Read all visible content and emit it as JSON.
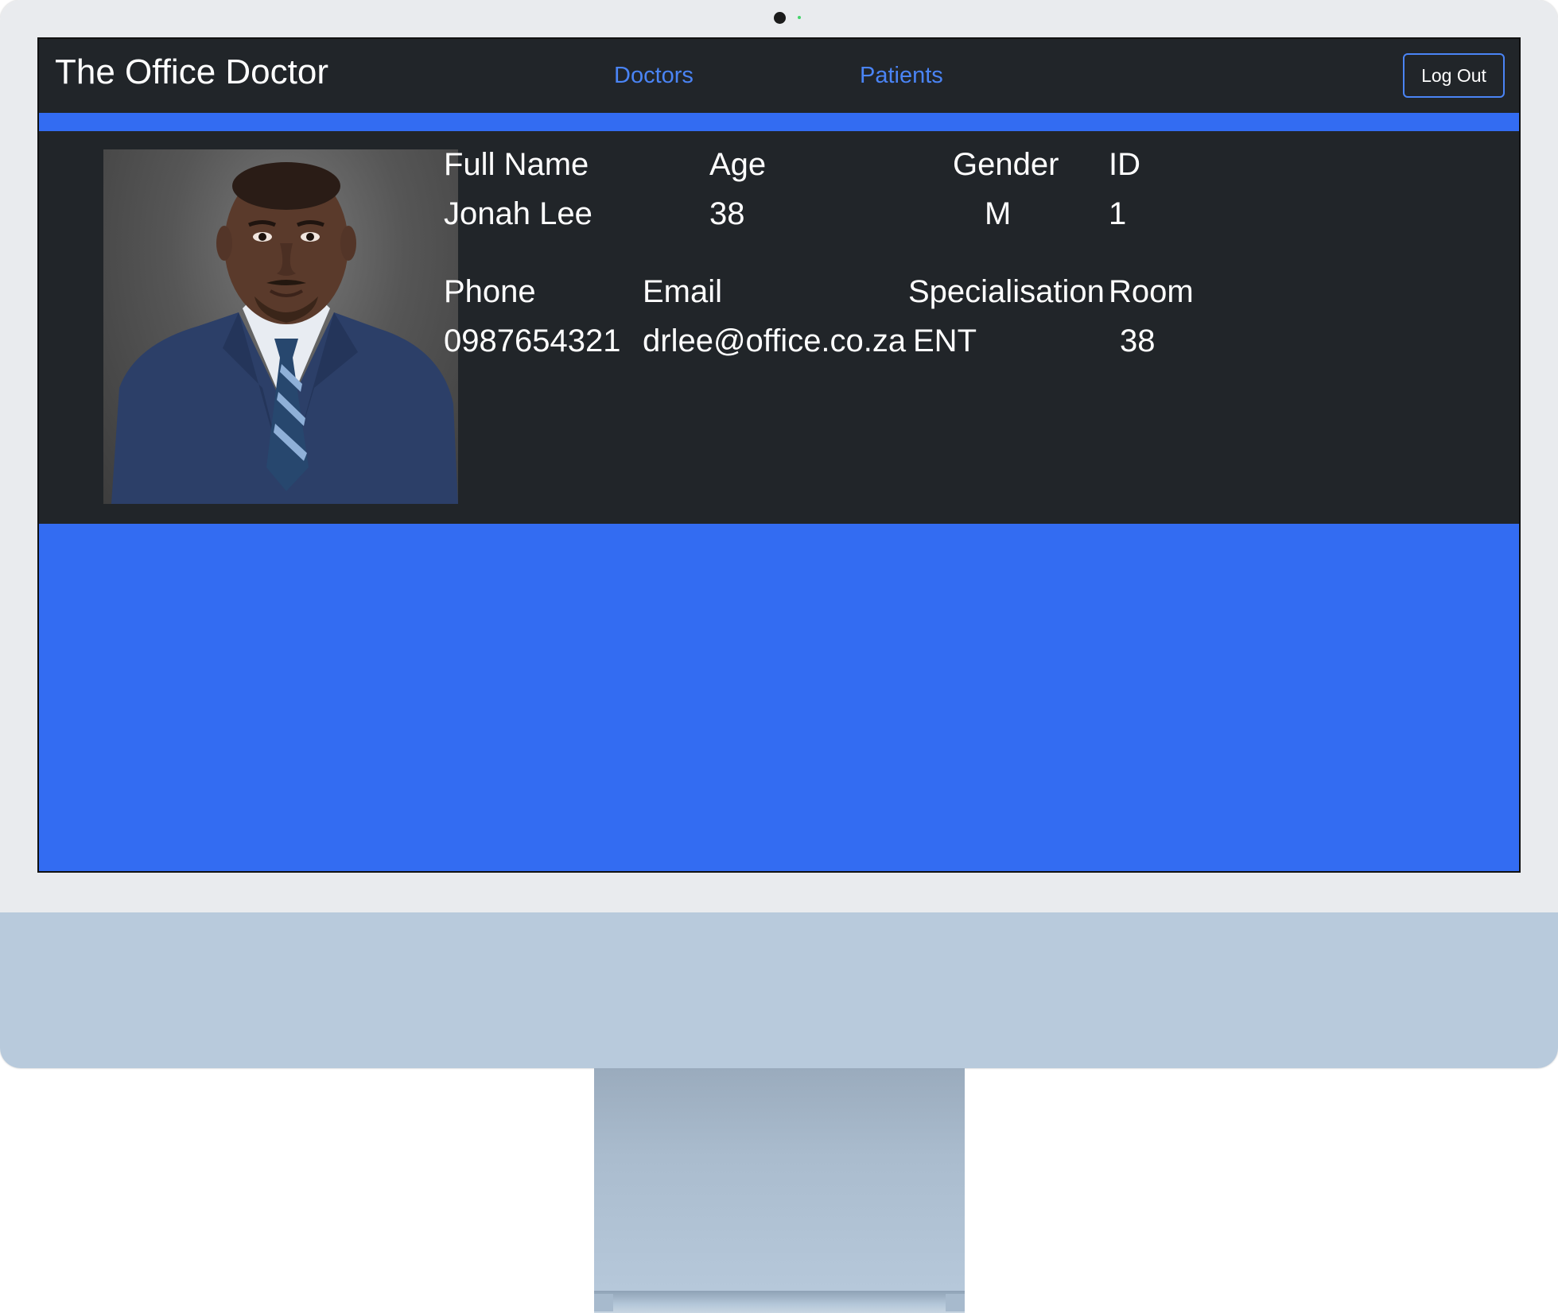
{
  "app": {
    "brand": "The Office Doctor"
  },
  "nav": {
    "doctors": "Doctors",
    "patients": "Patients",
    "logout": "Log Out"
  },
  "doctor": {
    "labels": {
      "full_name": "Full Name",
      "age": "Age",
      "gender": "Gender",
      "id": "ID",
      "phone": "Phone",
      "email": "Email",
      "specialisation": "Specialisation",
      "room": "Room"
    },
    "values": {
      "full_name": "Jonah Lee",
      "age": "38",
      "gender": "M",
      "id": "1",
      "phone": "0987654321",
      "email": "drlee@office.co.za",
      "specialisation": "ENT",
      "room": "38"
    }
  },
  "colors": {
    "accent": "#336cf2",
    "panel": "#212529",
    "link": "#4a84f5",
    "bezel": "#e9ebee",
    "chin": "#b8cadc"
  },
  "icons": {
    "photo": "doctor-portrait"
  }
}
